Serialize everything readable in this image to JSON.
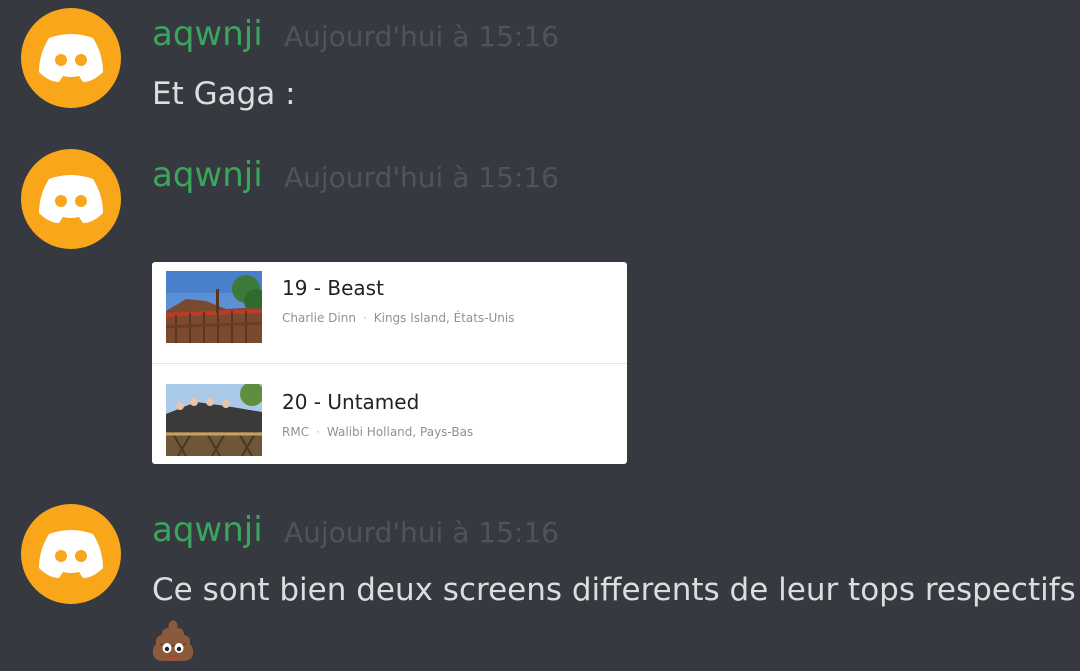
{
  "messages": [
    {
      "username": "aqwnji",
      "timestamp": "Aujourd'hui à 15:16",
      "text": "Et Gaga :"
    },
    {
      "username": "aqwnji",
      "timestamp": "Aujourd'hui à 15:16",
      "embed": {
        "items": [
          {
            "title": "19 - Beast",
            "maker": "Charlie Dinn",
            "location": "Kings Island, États-Unis"
          },
          {
            "title": "20 - Untamed",
            "maker": "RMC",
            "location": "Walibi Holland, Pays-Bas"
          }
        ]
      }
    },
    {
      "username": "aqwnji",
      "timestamp": "Aujourd'hui à 15:16",
      "text": "Ce sont bien deux screens differents de leur tops respectifs",
      "emoji": "poop-emoji"
    }
  ],
  "separator": "·",
  "colors": {
    "background": "#36393f",
    "username": "#3ba55c",
    "avatar": "#faa61a",
    "timestamp": "#4f545c",
    "text": "#dcddde"
  }
}
